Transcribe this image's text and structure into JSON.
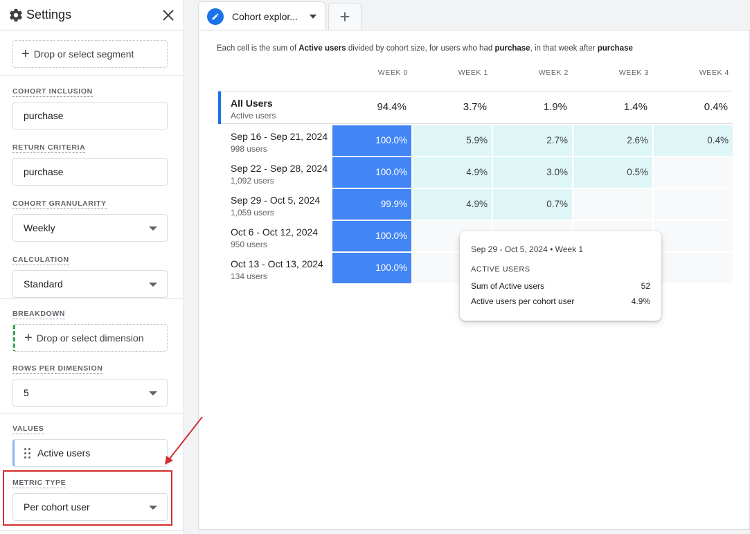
{
  "sidebar": {
    "title": "Settings",
    "segment_drop": "Drop or select segment",
    "cohort_inclusion": {
      "label": "COHORT INCLUSION",
      "value": "purchase"
    },
    "return_criteria": {
      "label": "RETURN CRITERIA",
      "value": "purchase"
    },
    "cohort_granularity": {
      "label": "COHORT GRANULARITY",
      "value": "Weekly"
    },
    "calculation": {
      "label": "CALCULATION",
      "value": "Standard"
    },
    "breakdown": {
      "label": "BREAKDOWN",
      "drop": "Drop or select dimension"
    },
    "rows_per_dimension": {
      "label": "ROWS PER DIMENSION",
      "value": "5"
    },
    "values": {
      "label": "VALUES",
      "chip": "Active users"
    },
    "metric_type": {
      "label": "METRIC TYPE",
      "value": "Per cohort user"
    }
  },
  "tabs": {
    "active_label": "Cohort explor..."
  },
  "description": {
    "p1": "Each cell is the sum of ",
    "b1": "Active users",
    "p2": " divided by cohort size, for users who had ",
    "b2": "purchase",
    "p3": ", in that week after ",
    "b3": "purchase"
  },
  "table": {
    "columns": [
      "WEEK 0",
      "WEEK 1",
      "WEEK 2",
      "WEEK 3",
      "WEEK 4"
    ],
    "all_users": {
      "name": "All Users",
      "metric": "Active users",
      "values": [
        "94.4%",
        "3.7%",
        "1.9%",
        "1.4%",
        "0.4%"
      ]
    },
    "rows": [
      {
        "name": "Sep 16 - Sep 21, 2024",
        "users": "998 users",
        "values": [
          "100.0%",
          "5.9%",
          "2.7%",
          "2.6%",
          "0.4%"
        ]
      },
      {
        "name": "Sep 22 - Sep 28, 2024",
        "users": "1,092 users",
        "values": [
          "100.0%",
          "4.9%",
          "3.0%",
          "0.5%",
          ""
        ]
      },
      {
        "name": "Sep 29 - Oct 5, 2024",
        "users": "1,059 users",
        "values": [
          "99.9%",
          "4.9%",
          "0.7%",
          "",
          ""
        ]
      },
      {
        "name": "Oct 6 - Oct 12, 2024",
        "users": "950 users",
        "values": [
          "100.0%",
          "",
          "",
          "",
          ""
        ]
      },
      {
        "name": "Oct 13 - Oct 13, 2024",
        "users": "134 users",
        "values": [
          "100.0%",
          "",
          "",
          "",
          ""
        ]
      }
    ]
  },
  "tooltip": {
    "heading": "Sep 29 - Oct 5, 2024 • Week 1",
    "section": "ACTIVE USERS",
    "sum_label": "Sum of Active users",
    "sum_value": "52",
    "per_label": "Active users per cohort user",
    "per_value": "4.9%"
  },
  "colors": {
    "accent": "#1a73e8",
    "cell_full": "#4285f4",
    "cell_light": "#dff6f7",
    "annotation": "#d32f2f"
  }
}
